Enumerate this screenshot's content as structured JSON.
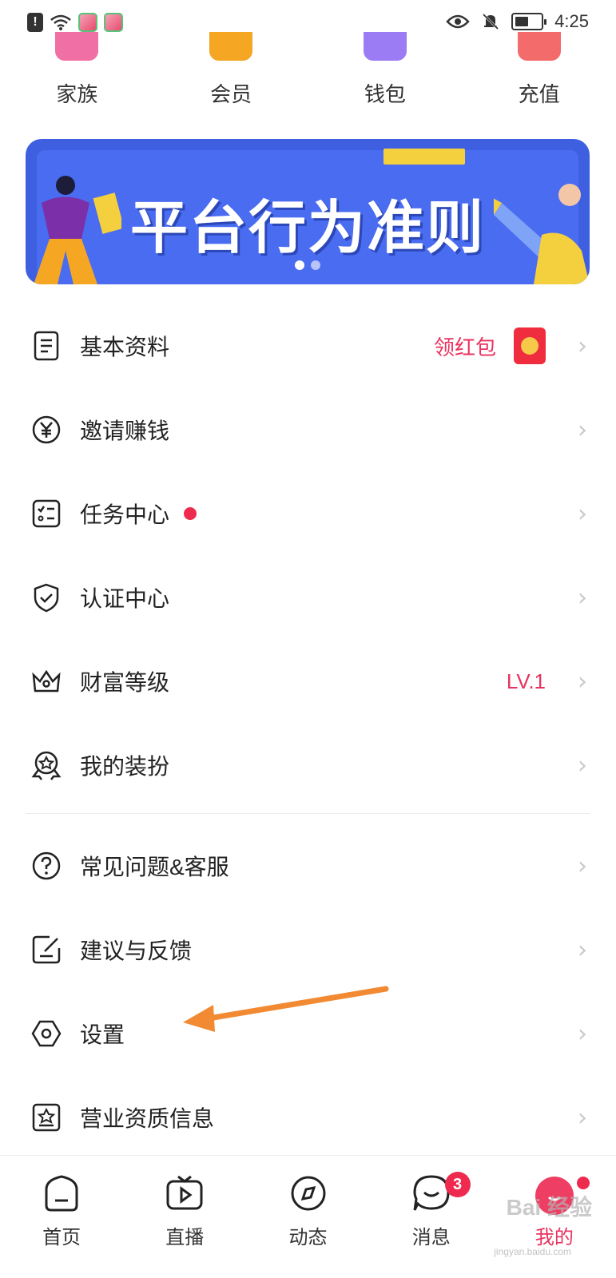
{
  "status_bar": {
    "time": "4:25"
  },
  "quick_actions": [
    {
      "label": "家族",
      "color": "#f06fa4"
    },
    {
      "label": "会员",
      "color": "#f5a623"
    },
    {
      "label": "钱包",
      "color": "#9b7cf5"
    },
    {
      "label": "充值",
      "color": "#f36b6b"
    }
  ],
  "banner": {
    "title": "平台行为准则",
    "page_count": 2,
    "active_page": 1
  },
  "menu": {
    "profile": {
      "label": "基本资料",
      "extra": "领红包"
    },
    "invite": {
      "label": "邀请赚钱"
    },
    "tasks": {
      "label": "任务中心"
    },
    "verify": {
      "label": "认证中心"
    },
    "wealth": {
      "label": "财富等级",
      "extra": "LV.1"
    },
    "dressup": {
      "label": "我的装扮"
    },
    "faq": {
      "label": "常见问题&客服"
    },
    "feedback": {
      "label": "建议与反馈"
    },
    "settings": {
      "label": "设置"
    },
    "license": {
      "label": "营业资质信息"
    }
  },
  "bottom_nav": {
    "home": {
      "label": "首页"
    },
    "live": {
      "label": "直播"
    },
    "feed": {
      "label": "动态"
    },
    "messages": {
      "label": "消息",
      "badge": "3"
    },
    "me": {
      "label": "我的"
    }
  },
  "watermark": {
    "text": "Bai 经验",
    "sub": "jingyan.baidu.com"
  },
  "colors": {
    "accent": "#e8335f",
    "badge": "#ee2a4f",
    "banner": "#4a6cf0",
    "annotation": "#f28a33"
  }
}
